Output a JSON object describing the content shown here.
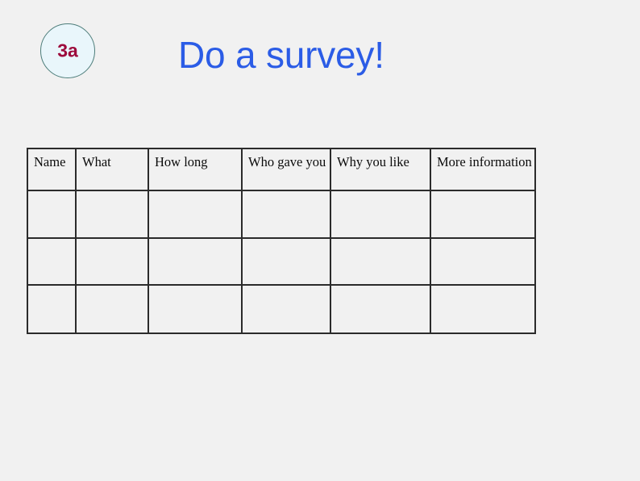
{
  "slide": {
    "background_color": "#f1f1f1"
  },
  "badge": {
    "label": "3a",
    "fill_color": "#e9f6fb",
    "border_color": "#4d7d7a",
    "text_color": "#9d0b3c"
  },
  "title": {
    "text": "Do a survey!",
    "color": "#2b5ce6"
  },
  "table": {
    "border_color": "#2b2b2b",
    "columns": [
      {
        "key": "name",
        "header": "Name"
      },
      {
        "key": "what",
        "header": "What"
      },
      {
        "key": "how_long",
        "header": "How long"
      },
      {
        "key": "who_gave_you",
        "header": "Who gave you"
      },
      {
        "key": "why_you_like",
        "header": "Why you like"
      },
      {
        "key": "more_information",
        "header": "More information"
      }
    ],
    "rows": [
      {
        "name": "",
        "what": "",
        "how_long": "",
        "who_gave_you": "",
        "why_you_like": "",
        "more_information": ""
      },
      {
        "name": "",
        "what": "",
        "how_long": "",
        "who_gave_you": "",
        "why_you_like": "",
        "more_information": ""
      },
      {
        "name": "",
        "what": "",
        "how_long": "",
        "who_gave_you": "",
        "why_you_like": "",
        "more_information": ""
      }
    ]
  }
}
